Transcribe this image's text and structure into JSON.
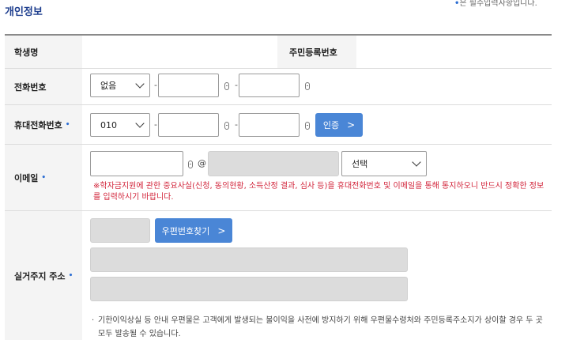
{
  "header": {
    "title": "개인정보",
    "required_note": "은 필수입력사항입니다.",
    "required_marker": "•"
  },
  "rows": {
    "student_name": {
      "label": "학생명",
      "value": ""
    },
    "resident_no": {
      "label": "주민등록번호",
      "value": ""
    },
    "phone": {
      "label": "전화번호",
      "area_select": "없음",
      "mid": "",
      "last": ""
    },
    "mobile": {
      "label": "휴대전화번호",
      "required": "•",
      "carrier_select": "010",
      "mid": "",
      "last": "",
      "verify_button": "인증"
    },
    "email": {
      "label": "이메일",
      "required": "•",
      "id": "",
      "at": "@",
      "domain": "",
      "domain_select": "선택",
      "warning": "※학자금지원에 관한 중요사실(신청, 동의현황, 소득산정 결과, 심사 등)을 휴대전화번호 및 이메일을 통해 통지하오니 반드시 정확한 정보를 입력하시기 바랍니다."
    },
    "address": {
      "label": "실거주지 주소",
      "required": "•",
      "zipcode": "",
      "zip_button": "우편번호찾기",
      "address1": "",
      "address2": "",
      "notice_bullet": "·",
      "notice": "기한이익상실 등 안내 우편물은 고객에게 발생되는 불이익을 사전에 방지하기 위해 우편물수령처와 주민등록주소지가 상이할 경우 두 곳 모두 발송될 수 있습니다."
    }
  },
  "colors": {
    "accent": "#4a86d6",
    "title": "#1f3f8f",
    "warning": "#d2243a",
    "required": "#2e6fd3"
  },
  "icons": {
    "dash": "-",
    "arrow": ">"
  }
}
